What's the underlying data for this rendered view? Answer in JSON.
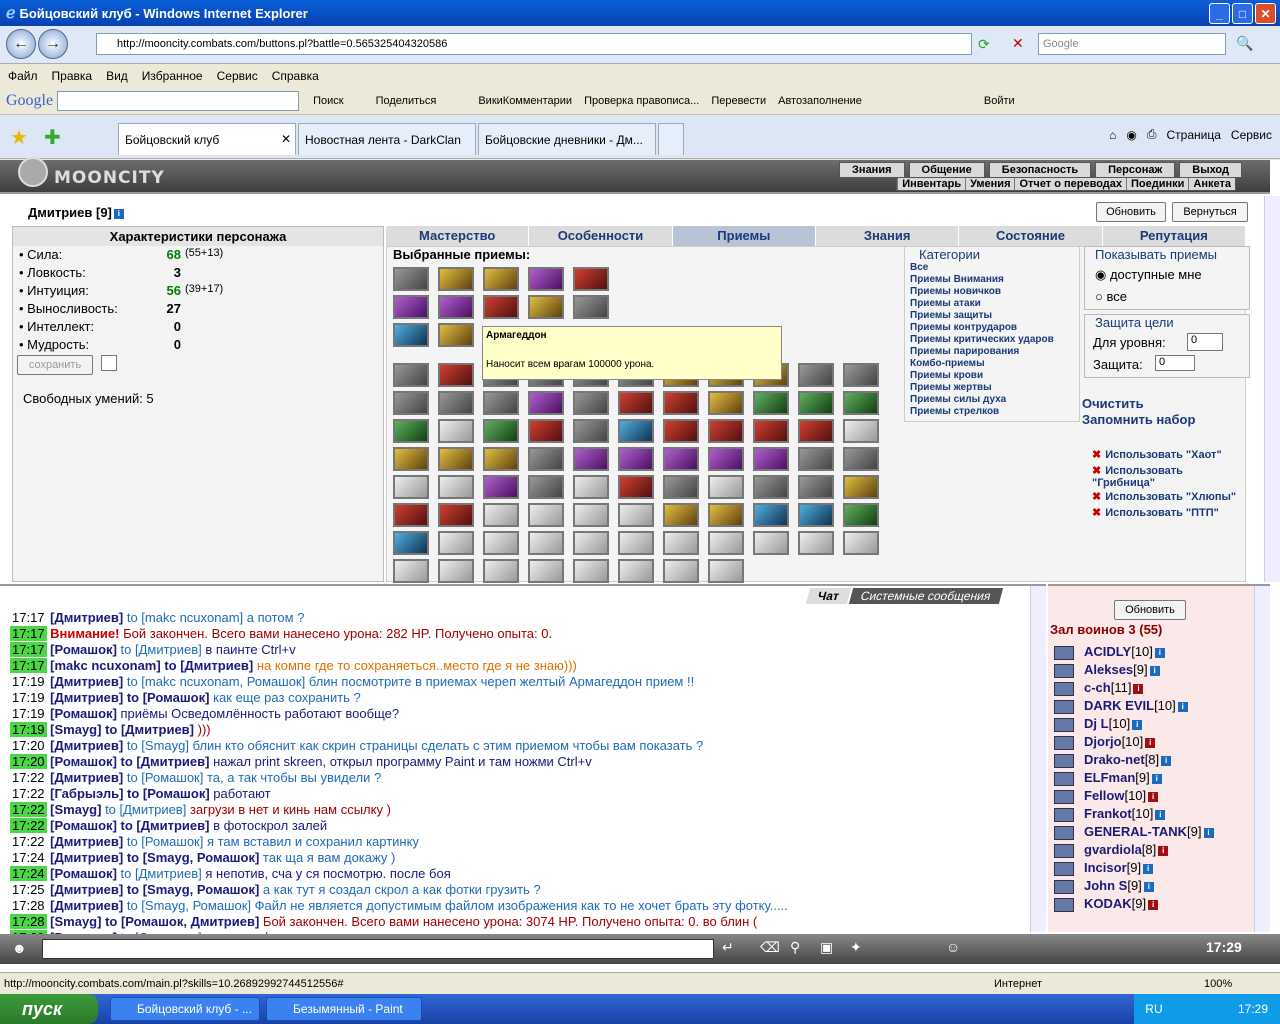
{
  "window": {
    "title": "Бойцовский клуб - Windows Internet Explorer"
  },
  "address": {
    "url": "http://mooncity.combats.com/buttons.pl?battle=0.565325404320586",
    "search_placeholder": "Google"
  },
  "menu": [
    "Файл",
    "Правка",
    "Вид",
    "Избранное",
    "Сервис",
    "Справка"
  ],
  "gbar": {
    "logo": "Google",
    "items": [
      "Поиск",
      "Поделиться",
      "",
      "ВикиКомментарии",
      "Проверка правописа...",
      "Перевести",
      "Автозаполнение",
      "",
      "Войти"
    ]
  },
  "tabs": [
    "Бойцовский клуб",
    "Новостная лента - DarkClan",
    "Бойцовские дневники - Дм..."
  ],
  "toolbar_right": [
    "Страница",
    "Сервис"
  ],
  "game": {
    "logo": "MOONCITY",
    "topnav": [
      "Знания",
      "Общение",
      "Безопасность",
      "Персонаж",
      "Выход"
    ],
    "subnav": [
      "Инвентарь",
      "Умения",
      "Отчет о переводах",
      "Поединки",
      "Анкета"
    ],
    "char_name": "Дмитриев [9]",
    "refresh": "Обновить",
    "back": "Вернуться",
    "panel_title": "Характеристики персонажа",
    "stats": [
      {
        "label": "Сила:",
        "value": "68",
        "extra": "(55+13)",
        "green": true
      },
      {
        "label": "Ловкость:",
        "value": "3",
        "extra": "",
        "green": false
      },
      {
        "label": "Интуиция:",
        "value": "56",
        "extra": "(39+17)",
        "green": true
      },
      {
        "label": "Выносливость:",
        "value": "27",
        "extra": "",
        "green": false
      },
      {
        "label": "Интеллект:",
        "value": "0",
        "extra": "",
        "green": false
      },
      {
        "label": "Мудрость:",
        "value": "0",
        "extra": "",
        "green": false
      }
    ],
    "save": "сохранить",
    "free_skills": "Свободных умений: 5",
    "maintabs": [
      "Мастерство",
      "Особенности",
      "Приемы",
      "Знания",
      "Состояние",
      "Репутация"
    ],
    "chosen": "Выбранные приемы:",
    "tooltip": {
      "title": "Армагеддон",
      "text": "Наносит всем врагам 100000 урона."
    },
    "cats_title": "Категории",
    "cats": [
      "Все",
      "Приемы Внимания",
      "Приемы новичков",
      "Приемы атаки",
      "Приемы защиты",
      "Приемы контрударов",
      "Приемы критических ударов",
      "Приемы парирования",
      "Комбо-приемы",
      "Приемы крови",
      "Приемы жертвы",
      "Приемы силы духа",
      "Приемы стрелков"
    ],
    "show_title": "Показывать приемы",
    "show_opts": [
      "доступные мне",
      "все"
    ],
    "target_title": "Защита цели",
    "level_label": "Для уровня:",
    "level_val": "0",
    "def_label": "Защита:",
    "def_val": "0",
    "clear": "Очистить",
    "remember": "Запомнить набор",
    "use_items": [
      "Использовать \"Хаот\"",
      "Использовать \"Грибница\"",
      "Использовать \"Хлюпы\"",
      "Использовать \"ПТП\""
    ]
  },
  "chat": {
    "tabs": [
      "Чат",
      "Системные сообщения"
    ],
    "lines": [
      {
        "t": "17:17",
        "n": "[Дмитриев]",
        "to": "to [makc ncuxonam]",
        "m": "а потом ?"
      },
      {
        "t": "17:17",
        "n": "Внимание!",
        "to": "",
        "m": "Бой закончен. Всего вами нанесено урона: 282 HP. Получено опыта: 0."
      },
      {
        "t": "17:17",
        "n": "[Ромашок]",
        "to": "to [Дмитриев]",
        "m": "в паинте Ctrl+v"
      },
      {
        "t": "17:17",
        "n": "[makc ncuxonam]",
        "to": "to [Дмитриев]",
        "m": "на компе где то сохраняеться..место где я не знаю)))"
      },
      {
        "t": "17:19",
        "n": "[Дмитриев]",
        "to": "to [makc ncuxonam, Ромашок]",
        "m": "блин посмотрите в приемах череп желтый Армагеддон прием !!"
      },
      {
        "t": "17:19",
        "n": "[Дмитриев]",
        "to": "to [Ромашок]",
        "m": "как еще раз сохранить ?"
      },
      {
        "t": "17:19",
        "n": "[Ромашок]",
        "to": "",
        "m": "приёмы Осведомлённость работают вообще?"
      },
      {
        "t": "17:19",
        "n": "[Smayg]",
        "to": "to [Дмитриев]",
        "m": ")))"
      },
      {
        "t": "17:20",
        "n": "[Дмитриев]",
        "to": "to [Smayg]",
        "m": "блин кто обяснит как скрин страницы сделать с этим приемом чтобы вам показать ?"
      },
      {
        "t": "17:20",
        "n": "[Ромашок]",
        "to": "to [Дмитриев]",
        "m": "нажал print skreen, открыл программу Paint и там ножми Ctrl+v"
      },
      {
        "t": "17:22",
        "n": "[Дмитриев]",
        "to": "to [Ромашок]",
        "m": "та, а так чтобы вы увидели ?"
      },
      {
        "t": "17:22",
        "n": "[Габрыэль]",
        "to": "to [Ромашок]",
        "m": "работают"
      },
      {
        "t": "17:22",
        "n": "[Smayg]",
        "to": "to [Дмитриев]",
        "m": "загрузи в нет и кинь нам ссылку )"
      },
      {
        "t": "17:22",
        "n": "[Ромашок]",
        "to": "to [Дмитриев]",
        "m": "в фотоскрол залей"
      },
      {
        "t": "17:22",
        "n": "[Дмитриев]",
        "to": "to [Ромашок]",
        "m": "я там вставил и сохранил картинку"
      },
      {
        "t": "17:24",
        "n": "[Дмитриев]",
        "to": "to [Smayg, Ромашок]",
        "m": "так ща я вам докажу )"
      },
      {
        "t": "17:24",
        "n": "[Ромашок]",
        "to": "to [Дмитриев]",
        "m": "я непотив, сча у ся посмотрю. после боя"
      },
      {
        "t": "17:25",
        "n": "[Дмитриев]",
        "to": "to [Smayg, Ромашок]",
        "m": "а как тут я создал скрол а как фотки грузить ?"
      },
      {
        "t": "17:28",
        "n": "[Дмитриев]",
        "to": "to [Smayg, Ромашок]",
        "m": "Файл не является допустимым файлом изображения как то не хочет брать эту фотку....."
      },
      {
        "t": "17:28",
        "n": "[Smayg]",
        "to": "to [Ромашок, Дмитриев]",
        "m": "Бой закончен. Всего вами нанесено урона: 3074 HP. Получено опыта: 0. во блин ("
      },
      {
        "t": "17:29",
        "n": "[Ромашок]",
        "to": "to [Дмитриев]",
        "m": "в другом формате сохрани"
      }
    ]
  },
  "users": {
    "refresh": "Обновить",
    "title": "Зал воинов 3 (55)",
    "list": [
      {
        "n": "ACIDLY",
        "l": "[10]"
      },
      {
        "n": "Alekses",
        "l": "[9]"
      },
      {
        "n": "c-ch",
        "l": "[11]"
      },
      {
        "n": "DARK EVIL",
        "l": "[10]"
      },
      {
        "n": "Dj L",
        "l": "[10]"
      },
      {
        "n": "Djorjo",
        "l": "[10]"
      },
      {
        "n": "Drako-net",
        "l": "[8]"
      },
      {
        "n": "ELFman",
        "l": "[9]"
      },
      {
        "n": "Fellow",
        "l": "[10]"
      },
      {
        "n": "Frankot",
        "l": "[10]"
      },
      {
        "n": "GENERAL-TANK",
        "l": "[9]"
      },
      {
        "n": "gvardiola",
        "l": "[8]"
      },
      {
        "n": "Incisor",
        "l": "[9]"
      },
      {
        "n": "John S",
        "l": "[9]"
      },
      {
        "n": "KODAK",
        "l": "[9]"
      }
    ]
  },
  "status": {
    "url": "http://mooncity.combats.com/main.pl?skills=10.26892992744512556#",
    "zone": "Интернет",
    "zoom": "100%"
  },
  "taskbar": {
    "start": "пуск",
    "items": [
      "Бойцовский клуб - ...",
      "Безымянный - Paint"
    ],
    "lang": "RU",
    "time": "17:29"
  },
  "clock": "17:29"
}
